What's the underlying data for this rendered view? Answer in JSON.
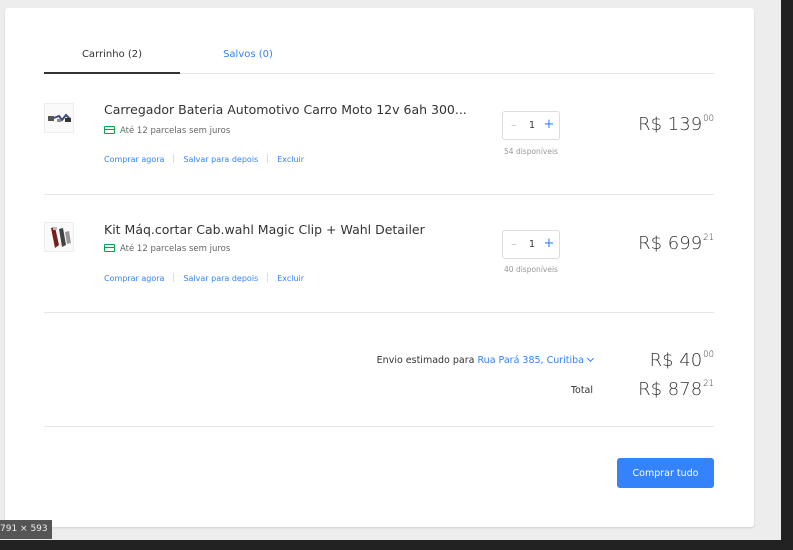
{
  "dims_badge": "791 × 593",
  "tabs": [
    {
      "label": "Carrinho (2)",
      "active": true
    },
    {
      "label": "Salvos (0)",
      "active": false
    }
  ],
  "items": [
    {
      "title": "Carregador Bateria Automotivo Carro Moto 12v 6ah 300...",
      "installments": "Até 12 parcelas sem juros",
      "actions": {
        "buy_now": "Comprar agora",
        "save_later": "Salvar para depois",
        "remove": "Excluir"
      },
      "quantity": "1",
      "minus": "–",
      "plus": "+",
      "available": "54 disponíveis",
      "price_int": "R$ 139",
      "price_cents": "00"
    },
    {
      "title": "Kit Máq.cortar Cab.wahl Magic Clip + Wahl Detailer",
      "installments": "Até 12 parcelas sem juros",
      "actions": {
        "buy_now": "Comprar agora",
        "save_later": "Salvar para depois",
        "remove": "Excluir"
      },
      "quantity": "1",
      "minus": "–",
      "plus": "+",
      "available": "40 disponíveis",
      "price_int": "R$ 699",
      "price_cents": "21"
    }
  ],
  "summary": {
    "shipping_label": "Envio estimado para",
    "shipping_address": "Rua Pará 385, Curitiba",
    "shipping_int": "R$ 40",
    "shipping_cents": "00",
    "total_label": "Total",
    "total_int": "R$ 878",
    "total_cents": "21"
  },
  "buy_all_label": "Comprar tudo",
  "colors": {
    "accent": "#3483fa",
    "installment_icon": "#00a650"
  }
}
